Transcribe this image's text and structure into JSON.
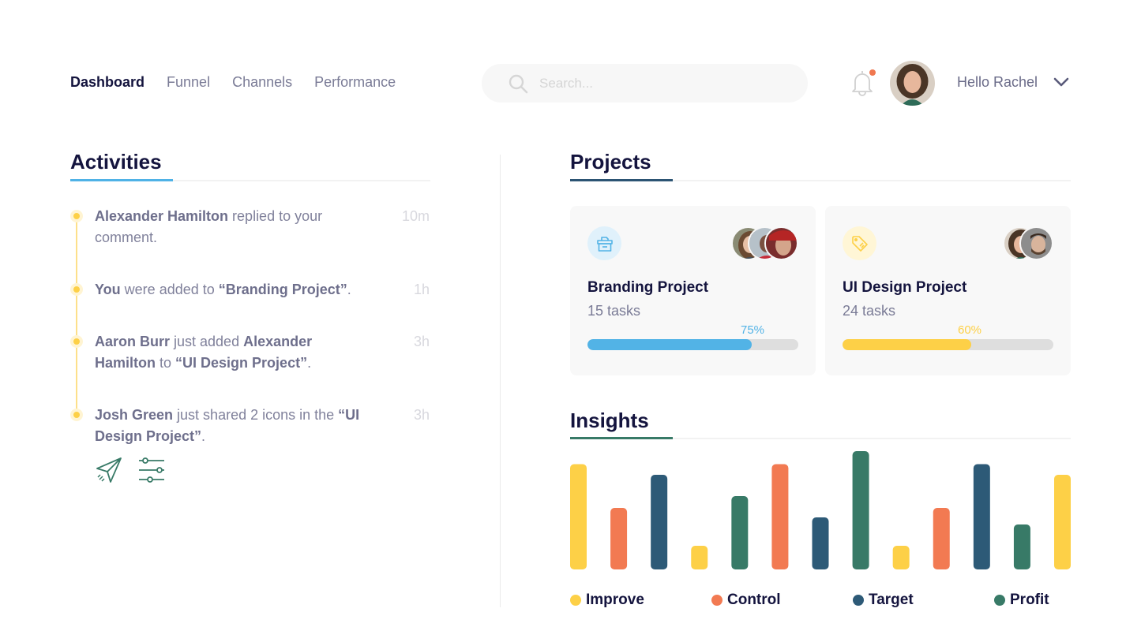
{
  "nav": {
    "items": [
      {
        "label": "Dashboard",
        "active": true
      },
      {
        "label": "Funnel",
        "active": false
      },
      {
        "label": "Channels",
        "active": false
      },
      {
        "label": "Performance",
        "active": false
      }
    ]
  },
  "search": {
    "placeholder": "Search...",
    "value": "",
    "icon": "search-icon"
  },
  "header": {
    "notification_icon": "bell-icon",
    "has_notification": true,
    "greeting": "Hello Rachel",
    "menu_icon": "chevron-down-icon"
  },
  "activities": {
    "title": "Activities",
    "accent_color": "#4fb2e6",
    "items": [
      {
        "parts": [
          {
            "b": "Alexander Hamilton"
          },
          {
            "t": " replied to your comment."
          }
        ],
        "time": "10m"
      },
      {
        "parts": [
          {
            "b": "You"
          },
          {
            "t": " were added to "
          },
          {
            "b": "“Branding Project”"
          },
          {
            "t": "."
          }
        ],
        "time": "1h"
      },
      {
        "parts": [
          {
            "b": "Aaron Burr"
          },
          {
            "t": " just added "
          },
          {
            "b": "Alexander Hamilton"
          },
          {
            "t": " to "
          },
          {
            "b": "“UI Design Project”"
          },
          {
            "t": "."
          }
        ],
        "time": "3h"
      },
      {
        "parts": [
          {
            "b": "Josh Green"
          },
          {
            "t": " just shared 2 icons in the "
          },
          {
            "b": "“UI Design Project”"
          },
          {
            "t": "."
          }
        ],
        "time": "3h"
      }
    ],
    "shared_icons": [
      "paper-plane-icon",
      "sliders-icon"
    ]
  },
  "projects": {
    "title": "Projects",
    "accent_color": "#2c5473",
    "cards": [
      {
        "name": "Branding Project",
        "tasks": "15 tasks",
        "progress_label": "75%",
        "progress": 0.78,
        "color": "#52b3e6",
        "icon": "archive-box-icon",
        "icon_bg": "#e0f1fb",
        "members": 3
      },
      {
        "name": "UI Design Project",
        "tasks": "24 tasks",
        "progress_label": "60%",
        "progress": 0.61,
        "color": "#fdd047",
        "icon": "price-tag-icon",
        "icon_bg": "#fff6d6",
        "members": 2
      }
    ]
  },
  "insights": {
    "title": "Insights",
    "accent_color": "#387a67"
  },
  "chart_data": {
    "type": "bar",
    "title": "Insights",
    "xlabel": "",
    "ylabel": "",
    "ylim": [
      0,
      100
    ],
    "grid": false,
    "legend_position": "bottom",
    "legend": [
      {
        "name": "Improve",
        "color": "#fdd047"
      },
      {
        "name": "Control",
        "color": "#f27a52"
      },
      {
        "name": "Target",
        "color": "#2d5a77"
      },
      {
        "name": "Profit",
        "color": "#387a67"
      }
    ],
    "bars": [
      {
        "series": "Improve",
        "value": 89
      },
      {
        "series": "Control",
        "value": 52
      },
      {
        "series": "Target",
        "value": 80
      },
      {
        "series": "Improve",
        "value": 20
      },
      {
        "series": "Profit",
        "value": 62
      },
      {
        "series": "Control",
        "value": 89
      },
      {
        "series": "Target",
        "value": 44
      },
      {
        "series": "Profit",
        "value": 100
      },
      {
        "series": "Improve",
        "value": 20
      },
      {
        "series": "Control",
        "value": 52
      },
      {
        "series": "Target",
        "value": 89
      },
      {
        "series": "Profit",
        "value": 38
      },
      {
        "series": "Improve",
        "value": 80
      }
    ]
  }
}
